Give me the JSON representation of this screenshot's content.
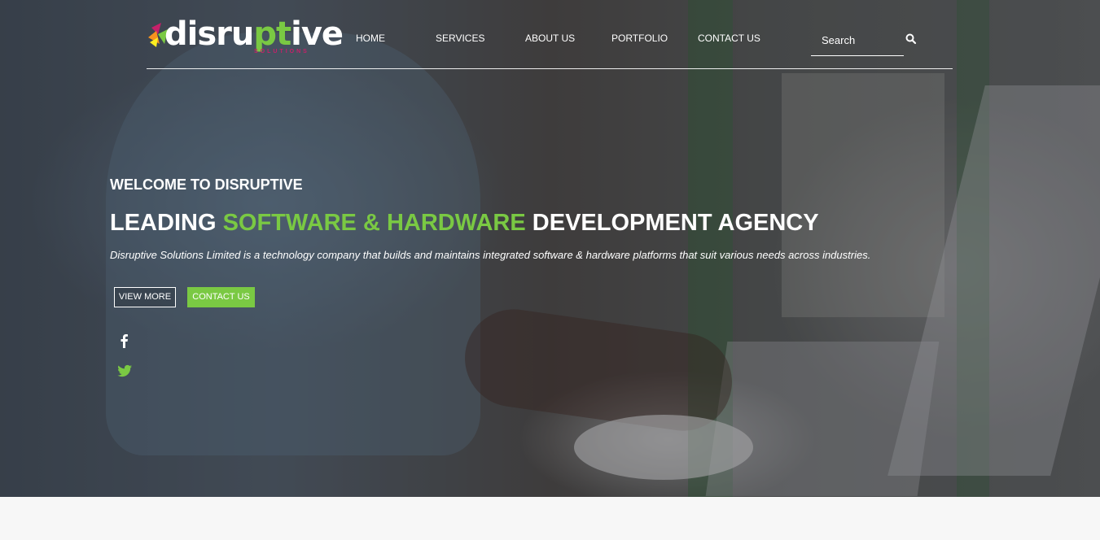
{
  "brand": {
    "logo_text_a": "disru",
    "logo_text_b": "pt",
    "logo_text_c": "ive",
    "logo_sub": "SOLUTIONS",
    "colors": {
      "accent": "#7ac943",
      "logo_magenta": "#c6206a"
    }
  },
  "nav": {
    "items": [
      {
        "label": "HOME"
      },
      {
        "label": "SERVICES"
      },
      {
        "label": "ABOUT US"
      },
      {
        "label": "PORTFOLIO"
      },
      {
        "label": "CONTACT US"
      }
    ]
  },
  "search": {
    "placeholder": "Search",
    "icon": "search-icon"
  },
  "hero": {
    "welcome": "WELCOME TO DISRUPTIVE",
    "headline_pre": "LEADING ",
    "headline_accent": "SOFTWARE & HARDWARE",
    "headline_post": " DEVELOPMENT AGENCY",
    "tagline": "Disruptive Solutions Limited is a technology company that builds and maintains integrated software & hardware platforms that suit various needs across industries.",
    "buttons": {
      "view_more": "VIEW MORE",
      "contact_us": "CONTACT US"
    }
  },
  "social": {
    "icons": [
      "facebook-icon",
      "twitter-icon"
    ],
    "colors": {
      "facebook": "#ffffff",
      "twitter": "#7ac943"
    }
  }
}
